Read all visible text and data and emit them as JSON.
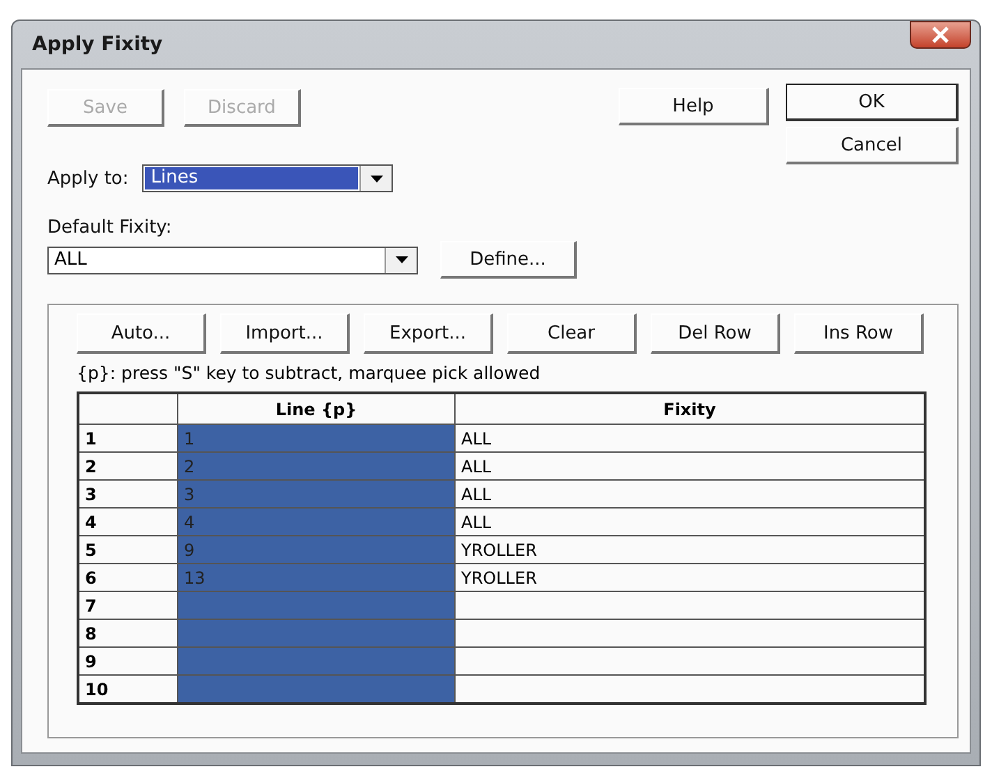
{
  "window": {
    "title": "Apply Fixity"
  },
  "top_buttons": [
    {
      "label": "Save",
      "disabled": true
    },
    {
      "label": "Discard",
      "disabled": true
    }
  ],
  "help_button": {
    "label": "Help"
  },
  "ok_button": {
    "label": "OK",
    "default": true
  },
  "cancel_button": {
    "label": "Cancel"
  },
  "apply_to": {
    "label": "Apply to:",
    "value": "Lines",
    "highlighted": true
  },
  "default_fixity": {
    "label": "Default Fixity:",
    "value": "ALL",
    "define_button": "Define..."
  },
  "table_buttons": [
    "Auto...",
    "Import...",
    "Export...",
    "Clear",
    "Del Row",
    "Ins Row"
  ],
  "hint": "{p}: press \"S\" key to subtract, marquee pick allowed",
  "table": {
    "columns": [
      "Line {p}",
      "Fixity"
    ],
    "rows": [
      {
        "number": "1",
        "line": "1",
        "fixity": "ALL",
        "line_selected": true
      },
      {
        "number": "2",
        "line": "2",
        "fixity": "ALL",
        "line_selected": true
      },
      {
        "number": "3",
        "line": "3",
        "fixity": "ALL",
        "line_selected": true
      },
      {
        "number": "4",
        "line": "4",
        "fixity": "ALL",
        "line_selected": true
      },
      {
        "number": "5",
        "line": "9",
        "fixity": "YROLLER",
        "line_selected": true
      },
      {
        "number": "6",
        "line": "13",
        "fixity": "YROLLER",
        "line_selected": true
      },
      {
        "number": "7",
        "line_selected": true
      },
      {
        "number": "8",
        "line_selected": true
      },
      {
        "number": "9",
        "line_selected": true
      },
      {
        "number": "10",
        "line_selected": true
      }
    ]
  }
}
